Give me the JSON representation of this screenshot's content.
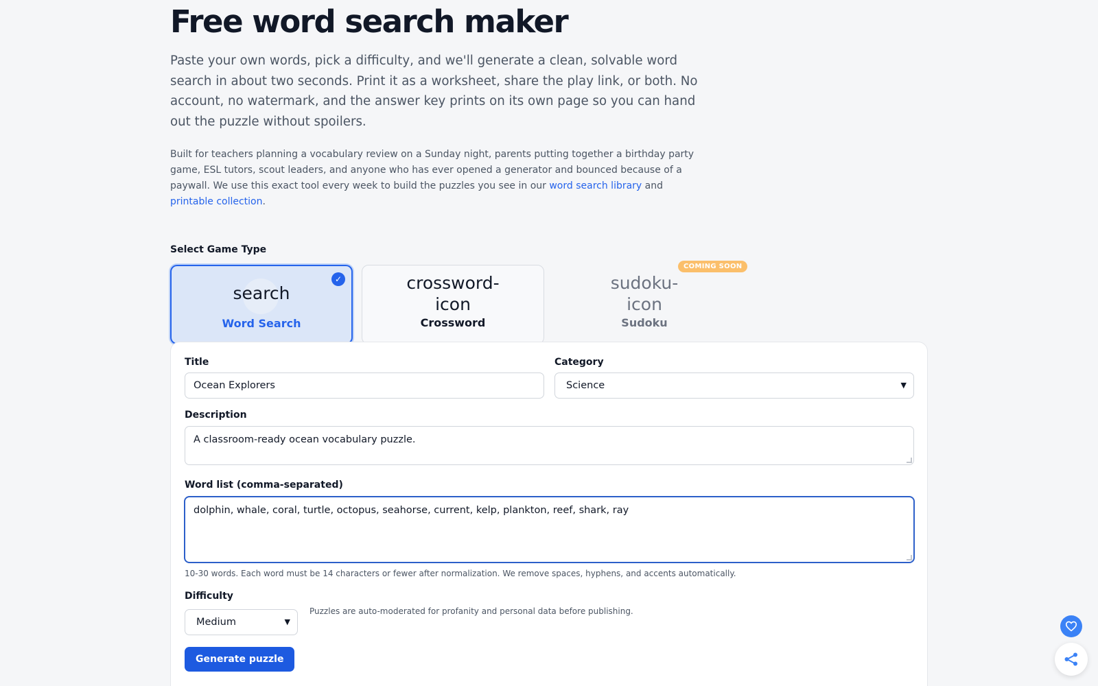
{
  "page": {
    "title": "Free word search maker",
    "intro": "Paste your own words, pick a difficulty, and we'll generate a clean, solvable word search in about two seconds. Print it as a worksheet, share the play link, or both. No account, no watermark, and the answer key prints on its own page so you can hand out the puzzle without spoilers.",
    "sub_intro_before": "Built for teachers planning a vocabulary review on a Sunday night, parents putting together a birthday party game, ESL tutors, scout leaders, and anyone who has ever opened a generator and bounced because of a paywall. We use this exact tool every week to build the puzzles you see in our ",
    "link_library": "word search library",
    "sub_intro_and": " and ",
    "link_printable": "printable collection",
    "sub_intro_end": "."
  },
  "game_type": {
    "label": "Select Game Type",
    "cards": [
      {
        "icon": "search",
        "label": "Word Search",
        "selected": true
      },
      {
        "icon": "crossword-icon",
        "label": "Crossword",
        "selected": false
      },
      {
        "icon": "sudoku-icon",
        "label": "Sudoku",
        "selected": false,
        "badge": "COMING SOON"
      }
    ],
    "check": "✓"
  },
  "form": {
    "title_label": "Title",
    "title_value": "Ocean Explorers",
    "category_label": "Category",
    "category_value": "Science",
    "description_label": "Description",
    "description_value": "A classroom-ready ocean vocabulary puzzle.",
    "words_label": "Word list (comma-separated)",
    "words_value": "dolphin, whale, coral, turtle, octopus, seahorse, current, kelp, plankton, reef, shark, ray",
    "words_hint": "10-30 words. Each word must be 14 characters or fewer after normalization. We remove spaces, hyphens, and accents automatically.",
    "difficulty_label": "Difficulty",
    "difficulty_value": "Medium",
    "moderation_note": "Puzzles are auto-moderated for profanity and personal data before publishing.",
    "generate_label": "Generate puzzle"
  },
  "colors": {
    "accent": "#2563eb",
    "badge": "#fbbf6b"
  }
}
